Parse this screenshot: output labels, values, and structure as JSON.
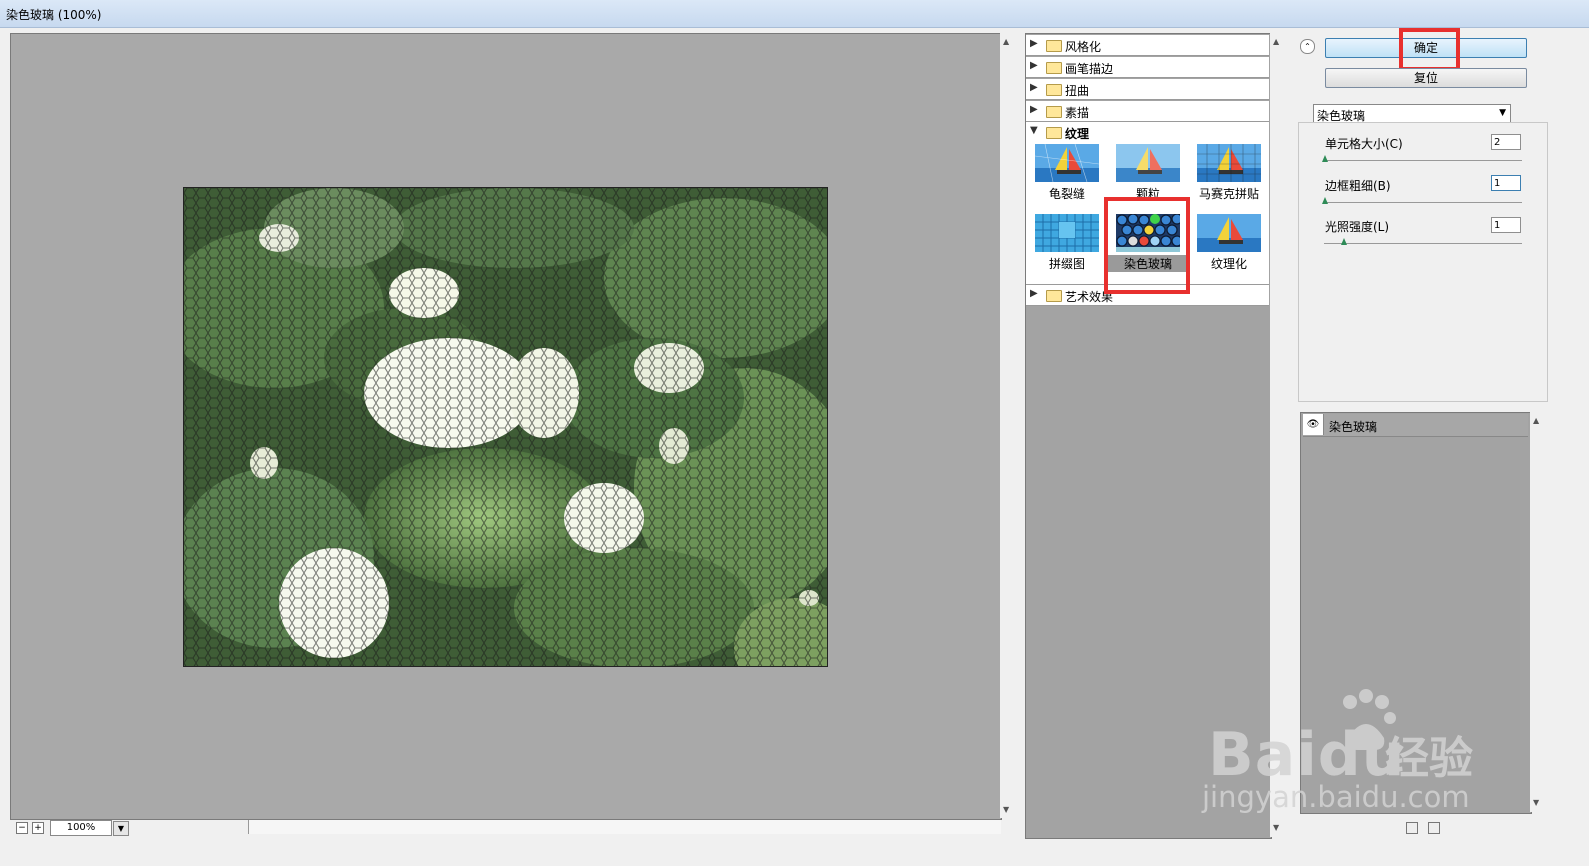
{
  "window": {
    "title": "染色玻璃 (100%)"
  },
  "preview": {
    "zoom": "100%"
  },
  "gallery": {
    "categories": [
      {
        "label": "风格化",
        "expanded": false
      },
      {
        "label": "画笔描边",
        "expanded": false
      },
      {
        "label": "扭曲",
        "expanded": false
      },
      {
        "label": "素描",
        "expanded": false
      },
      {
        "label": "纹理",
        "expanded": true
      },
      {
        "label": "艺术效果",
        "expanded": false
      }
    ],
    "thumbs": [
      {
        "label": "龟裂缝"
      },
      {
        "label": "颗粒"
      },
      {
        "label": "马赛克拼贴"
      },
      {
        "label": "拼缀图"
      },
      {
        "label": "染色玻璃",
        "selected": true
      },
      {
        "label": "纹理化"
      }
    ]
  },
  "buttons": {
    "ok": "确定",
    "reset": "复位"
  },
  "filter": {
    "selected": "染色玻璃"
  },
  "params": [
    {
      "label": "单元格大小(C)",
      "value": "2"
    },
    {
      "label": "边框粗细(B)",
      "value": "1"
    },
    {
      "label": "光照强度(L)",
      "value": "1"
    }
  ],
  "layers": [
    {
      "label": "染色玻璃",
      "visible": true
    }
  ],
  "watermark": {
    "brand": "Baidu",
    "cn": "经验",
    "url": "jingyan.baidu.com"
  },
  "colors": {
    "highlight": "#e8302e",
    "preview_bg": "#a9a9a9"
  }
}
